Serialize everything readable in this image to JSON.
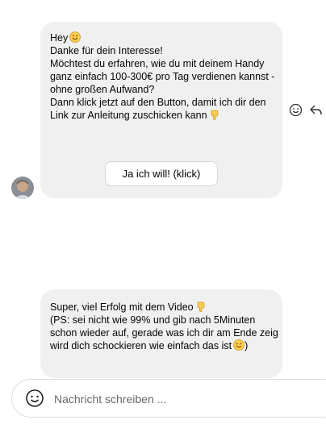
{
  "message1": {
    "greeting": "Hey",
    "greeting_emoji": "smiling-face-emoji",
    "lines": [
      "Danke für dein Interesse!",
      "Möchtest du erfahren, wie du mit deinem Handy",
      "ganz einfach 100-300€ pro Tag verdienen kannst -",
      "ohne großen Aufwand?",
      "Dann klick jetzt auf den Button, damit ich dir den",
      "Link zur Anleitung zuschicken kann"
    ],
    "pointing_emoji": "backhand-index-pointing-down-emoji",
    "button_label": "Ja ich will! (klick)"
  },
  "message2": {
    "lines": [
      "Super, viel Erfolg mit dem Video",
      "(PS: sei nicht wie 99% und gib nach 5Minuten",
      "schon wieder auf, gerade was ich dir am Ende zeig",
      "wird dich schockieren wie einfach das ist",
      ")"
    ],
    "pointing_emoji": "backhand-index-pointing-down-emoji",
    "smile_emoji": "smiling-face-emoji"
  },
  "message_actions": [
    "react-icon",
    "reply-icon"
  ],
  "composer": {
    "placeholder": "Nachricht schreiben ...",
    "value": ""
  },
  "colors": {
    "bubble": "#f0f0f0",
    "emoji_yellow": "#ffcc4d",
    "placeholder": "#65676b"
  }
}
